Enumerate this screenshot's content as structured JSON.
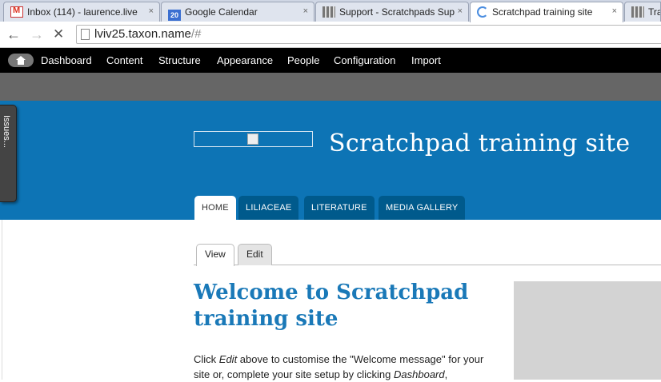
{
  "browser": {
    "tabs": [
      {
        "title": "Inbox (114) - laurence.live",
        "icon": "gmail-icon",
        "active": false
      },
      {
        "title": "Google Calendar",
        "icon": "calendar-icon",
        "active": false,
        "icon_text": "20"
      },
      {
        "title": "Support - Scratchpads Sup",
        "icon": "grid-icon",
        "active": false
      },
      {
        "title": "Scratchpad training site",
        "icon": "loading-spinner-icon",
        "active": true
      },
      {
        "title": "Trai",
        "icon": "grid-icon",
        "active": false
      }
    ],
    "close_glyph": "×",
    "url_host": "lviv25.taxon.name",
    "url_path": "/#"
  },
  "admin_menu": {
    "items": [
      "Dashboard",
      "Content",
      "Structure",
      "Appearance",
      "People",
      "Configuration",
      "Import"
    ]
  },
  "issues_tab": {
    "label": "Issues..."
  },
  "site": {
    "title": "Scratchpad training site",
    "primary_tabs": [
      "HOME",
      "LILIACEAE",
      "LITERATURE",
      "MEDIA GALLERY"
    ]
  },
  "page": {
    "secondary_tabs": [
      "View",
      "Edit"
    ],
    "heading": "Welcome to Scratchpad training site",
    "intro_before_edit": "Click ",
    "intro_edit": "Edit",
    "intro_middle": " above to customise the \"Welcome message\" for your site or, complete your site setup by clicking ",
    "intro_dashboard": "Dashboard",
    "intro_after": ","
  },
  "colors": {
    "header_blue": "#0d74b5",
    "tab_dark_blue": "#005a8c",
    "heading_blue": "#1a79b8"
  }
}
